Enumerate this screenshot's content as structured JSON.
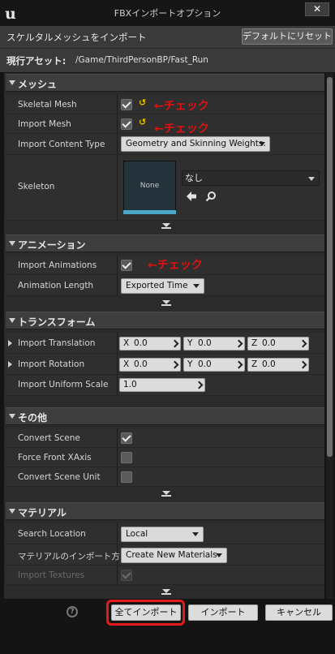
{
  "window": {
    "title": "FBXインポートオプション",
    "close_glyph": "✕"
  },
  "header": {
    "text": "スケルタルメッシュをインポート",
    "reset_label": "デフォルトにリセット"
  },
  "asset": {
    "label": "現行アセット:",
    "path": "/Game/ThirdPersonBP/Fast_Run"
  },
  "annotation": {
    "check_note": "←チェック"
  },
  "mesh": {
    "title": "メッシュ",
    "skeletal_mesh": {
      "label": "Skeletal Mesh",
      "checked": true
    },
    "import_mesh": {
      "label": "Import Mesh",
      "checked": true
    },
    "content_type": {
      "label": "Import Content Type",
      "value": "Geometry and Skinning Weights."
    },
    "skeleton": {
      "label": "Skeleton",
      "thumb_label": "None",
      "value": "なし"
    }
  },
  "animation": {
    "title": "アニメーション",
    "import_animations": {
      "label": "Import Animations",
      "checked": true
    },
    "animation_length": {
      "label": "Animation Length",
      "value": "Exported Time"
    }
  },
  "transform": {
    "title": "トランスフォーム",
    "translation": {
      "label": "Import Translation",
      "x": "0.0",
      "y": "0.0",
      "z": "0.0"
    },
    "rotation": {
      "label": "Import Rotation",
      "x": "0.0",
      "y": "0.0",
      "z": "0.0"
    },
    "uniform_scale": {
      "label": "Import Uniform Scale",
      "value": "1.0"
    },
    "axis_x": "X",
    "axis_y": "Y",
    "axis_z": "Z"
  },
  "misc": {
    "title": "その他",
    "convert_scene": {
      "label": "Convert Scene",
      "checked": true
    },
    "force_front_xaxis": {
      "label": "Force Front XAxis",
      "checked": false
    },
    "convert_scene_unit": {
      "label": "Convert Scene Unit",
      "checked": false
    }
  },
  "material": {
    "title": "マテリアル",
    "search_location": {
      "label": "Search Location",
      "value": "Local"
    },
    "material_import": {
      "label": "マテリアルのインポート方",
      "value": "Create New Materials"
    },
    "import_textures": {
      "label": "Import Textures",
      "checked": true,
      "enabled": false
    }
  },
  "footer": {
    "import_all": "全てインポート",
    "import": "インポート",
    "cancel": "キャンセル",
    "help_glyph": "?"
  },
  "colors": {
    "annotation_red": "#e51a1a",
    "reset_yellow": "#e8c300",
    "thumb_accent": "#4ba6c8"
  }
}
